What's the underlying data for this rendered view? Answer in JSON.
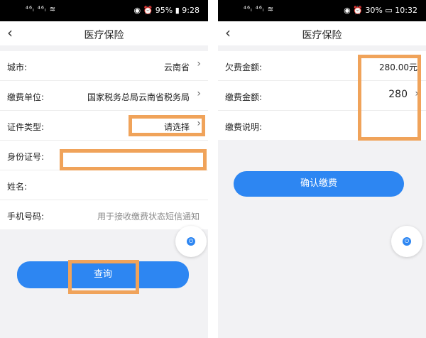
{
  "left": {
    "status_bar": {
      "left": "⁴⁶ₗ ⁴⁶ₗ ≋",
      "battery": "95%",
      "time": "9:28"
    },
    "nav": {
      "back": "‹",
      "title": "医疗保险"
    },
    "rows": {
      "city": {
        "label": "城市:",
        "value": "云南省"
      },
      "unit": {
        "label": "缴费单位:",
        "value": "国家税务总局云南省税务局"
      },
      "id_type": {
        "label": "证件类型:",
        "value": "请选择"
      },
      "id_number": {
        "label": "身份证号:"
      },
      "name": {
        "label": "姓名:"
      },
      "phone": {
        "label": "手机号码:",
        "placeholder": "用于接收缴费状态短信通知"
      }
    },
    "query_button": "查询"
  },
  "right": {
    "status_bar": {
      "left": "⁴⁶ₗ ⁴⁶ₗ ≋",
      "battery": "30%",
      "time": "10:32"
    },
    "nav": {
      "back": "‹",
      "title": "医疗保险"
    },
    "rows": {
      "arrears": {
        "label": "欠费金额:",
        "value": "280.00元"
      },
      "amount": {
        "label": "缴费金额:",
        "value": "280"
      },
      "note": {
        "label": "缴费说明:"
      }
    },
    "confirm_button": "确认缴费"
  },
  "colors": {
    "accent": "#2d86f2",
    "highlight": "#f0a35a"
  },
  "icons": {
    "back": "chevron-left-icon",
    "row_arrow": "chevron-right-icon",
    "float": "power-icon"
  }
}
